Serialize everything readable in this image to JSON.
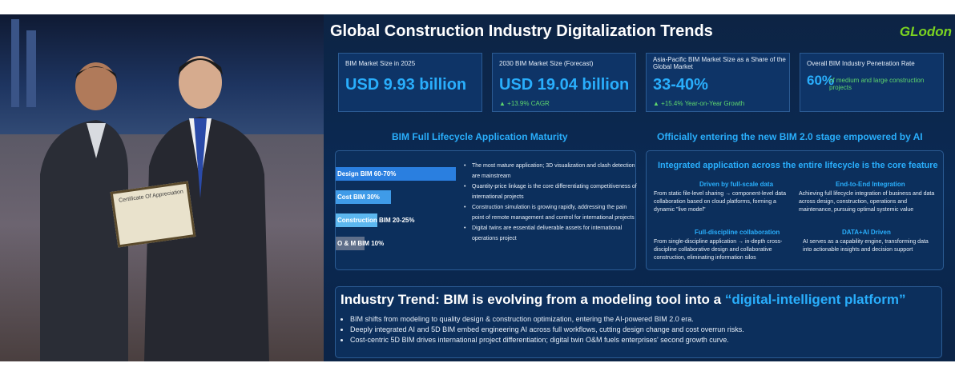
{
  "colors": {
    "accent": "#29aefc",
    "growth": "#5ed66d",
    "logo": "#7bd321",
    "slide_bg": "#0a2a55"
  },
  "photo": {
    "certificate_title": "Certificate Of Appreciation"
  },
  "slide": {
    "title": "Global Construction Industry Digitalization Trends",
    "logo": "GLodon",
    "kpis": [
      {
        "label": "BIM Market Size in 2025",
        "value": "USD 9.93 billion",
        "sub": ""
      },
      {
        "label": "2030 BIM Market Size (Forecast)",
        "value": "USD 19.04 billion",
        "sub": "▲ +13.9% CAGR"
      },
      {
        "label": "Asia-Pacific BIM Market Size as a Share of the Global Market",
        "value": "33-40%",
        "sub": "▲ +15.4% Year-on-Year Growth"
      },
      {
        "label": "Overall BIM Industry Penetration Rate",
        "value": "60%",
        "value_note": "of medium and large construction projects",
        "sub": ""
      }
    ],
    "left_section": {
      "heading": "BIM Full Lifecycle Application Maturity",
      "bars": [
        {
          "label": "Design BIM 60-70%",
          "value": 65
        },
        {
          "label": "Cost BIM  30%",
          "value": 30
        },
        {
          "label": "Construction BIM 20-25%",
          "value": 22.5
        },
        {
          "label": "O & M BIM 10%",
          "value": 10
        }
      ],
      "bullets": [
        "The most mature application; 3D visualization and clash detection are mainstream",
        "Quantity-price linkage is the core differentiating competitiveness of international projects",
        "Construction simulation is growing rapidly, addressing the pain point of remote management and control for international projects",
        "Digital twins are essential deliverable assets for international operations project"
      ]
    },
    "right_section": {
      "heading": "Officially entering the new BIM 2.0 stage empowered by AI",
      "subheading": "Integrated application across the entire lifecycle is the core feature",
      "features": [
        {
          "title": "Driven by full-scale data",
          "text": "From static file-level sharing → component-level data collaboration based on cloud platforms, forming a dynamic \"live model\""
        },
        {
          "title": "End-to-End Integration",
          "text": "Achieving full lifecycle integration of business and data across design, construction, operations and maintenance, pursuing optimal systemic value"
        },
        {
          "title": "Full-discipline collaboration",
          "text": "From single-discipline application → in-depth cross-discipline collaborative design and collaborative construction, eliminating information silos"
        },
        {
          "title": "DATA+AI Driven",
          "text": "AI serves as a capability engine, transforming data into actionable insights and decision support"
        }
      ]
    },
    "trend": {
      "heading_prefix": "Industry Trend: BIM is evolving from a modeling tool into a",
      "heading_highlight": "“digital-intelligent platform”",
      "bullets": [
        "BIM shifts from modeling to quality design & construction optimization, entering the AI-powered BIM 2.0 era.",
        "Deeply integrated AI and 5D BIM embed engineering AI across full workflows, cutting design change and cost overrun risks.",
        "Cost-centric 5D BIM drives international project differentiation; digital twin O&M fuels enterprises' second growth curve."
      ]
    }
  }
}
